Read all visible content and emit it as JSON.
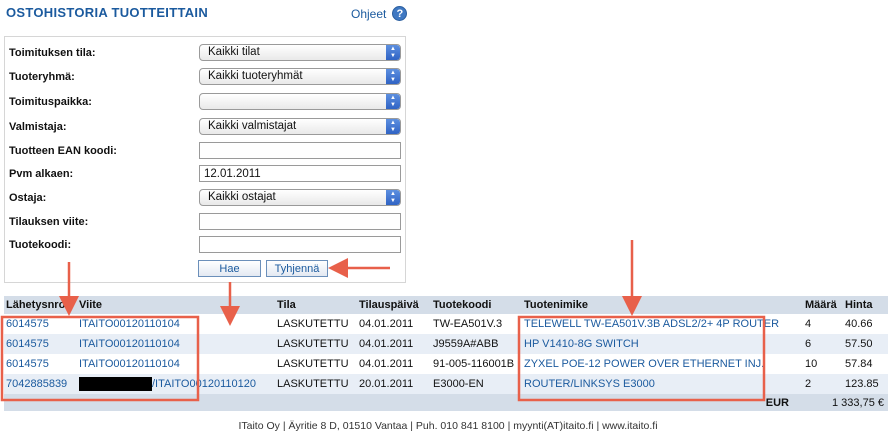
{
  "header": {
    "title": "OSTOHISTORIA TUOTTEITTAIN",
    "help_label": "Ohjeet"
  },
  "form": {
    "delivery_status": {
      "label": "Toimituksen tila:",
      "value": "Kaikki tilat"
    },
    "product_group": {
      "label": "Tuoteryhmä:",
      "value": "Kaikki tuoteryhmät"
    },
    "delivery_location": {
      "label": "Toimituspaikka:",
      "value": ""
    },
    "manufacturer": {
      "label": "Valmistaja:",
      "value": "Kaikki valmistajat"
    },
    "ean": {
      "label": "Tuotteen EAN koodi:",
      "value": ""
    },
    "date_from": {
      "label": "Pvm alkaen:",
      "value": "12.01.2011"
    },
    "buyer": {
      "label": "Ostaja:",
      "value": "Kaikki ostajat"
    },
    "order_ref": {
      "label": "Tilauksen viite:",
      "value": ""
    },
    "product_code": {
      "label": "Tuotekoodi:",
      "value": ""
    },
    "search_label": "Hae",
    "clear_label": "Tyhjennä"
  },
  "table": {
    "headers": [
      "Lähetysnro",
      "Viite",
      "Tila",
      "Tilauspäivä",
      "Tuotekoodi",
      "Tuotenimike",
      "Määrä",
      "Hinta"
    ],
    "rows": [
      {
        "shipment": "6014575",
        "ref": "ITAITO00120110104",
        "status": "LASKUTETTU",
        "date": "04.01.2011",
        "code": "TW-EA501V.3",
        "name": "TELEWELL TW-EA501V.3B ADSL2/2+ 4P ROUTER",
        "qty": "4",
        "price": "40.66"
      },
      {
        "shipment": "6014575",
        "ref": "ITAITO00120110104",
        "status": "LASKUTETTU",
        "date": "04.01.2011",
        "code": "J9559A#ABB",
        "name": "HP V1410-8G SWITCH",
        "qty": "6",
        "price": "57.50"
      },
      {
        "shipment": "6014575",
        "ref": "ITAITO00120110104",
        "status": "LASKUTETTU",
        "date": "04.01.2011",
        "code": "91-005-116001B",
        "name": "ZYXEL POE-12 POWER OVER ETHERNET INJ.",
        "qty": "10",
        "price": "57.84"
      },
      {
        "shipment": "7042885839",
        "ref": "/ITAITO00120110120",
        "status": "LASKUTETTU",
        "date": "20.01.2011",
        "code": "E3000-EN",
        "name": "ROUTER/LINKSYS E3000",
        "qty": "2",
        "price": "123.85"
      }
    ],
    "total_currency": "EUR",
    "total_value": "1 333,75 €"
  },
  "footer": {
    "text": "ITaito Oy | Äyritie 8 D, 01510 Vantaa | Puh. 010 841 8100 | myynti(AT)itaito.fi | www.itaito.fi"
  },
  "colors": {
    "accent": "#1b5a9e",
    "header_bg": "#d4dde8",
    "row_alt": "#e8eef6",
    "annotation": "#e8604a"
  }
}
